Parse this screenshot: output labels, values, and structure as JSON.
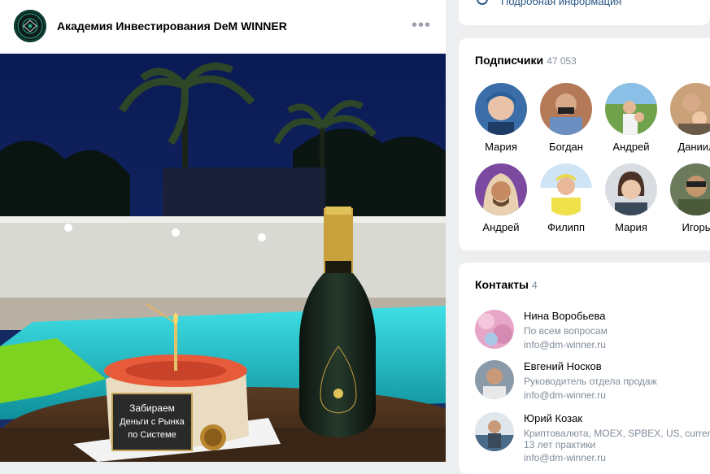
{
  "post": {
    "group_name": "Академия Инвестирования DeM WINNER",
    "more_icon": "more-horizontal-icon",
    "photo": {
      "cake_lines": [
        "Забираем",
        "Деньги с Рынка",
        "по Системе"
      ]
    }
  },
  "info": {
    "icon": "info-icon",
    "link_label": "Подробная информация"
  },
  "subscribers": {
    "title": "Подписчики",
    "count": "47 053",
    "items": [
      {
        "name": "Мария",
        "color": "#3b6ea8"
      },
      {
        "name": "Богдан",
        "color": "#8a6a58"
      },
      {
        "name": "Андрей",
        "color": "#5b8a3c"
      },
      {
        "name": "Даниил",
        "color": "#a07a52"
      },
      {
        "name": "Андрей",
        "color": "#7b4aa0"
      },
      {
        "name": "Филипп",
        "color": "#4d8fcf"
      },
      {
        "name": "Мария",
        "color": "#6f8fa8"
      },
      {
        "name": "Игорь",
        "color": "#5a6a4a"
      }
    ]
  },
  "contacts": {
    "title": "Контакты",
    "count": "4",
    "items": [
      {
        "name": "Нина Воробьева",
        "role": "По всем вопросам",
        "role2": "",
        "email": "info@dm-winner.ru",
        "color": "#e7a6c8"
      },
      {
        "name": "Евгений Носков",
        "role": "Руководитель отдела продаж",
        "role2": "",
        "email": "info@dm-winner.ru",
        "color": "#6b5a4a"
      },
      {
        "name": "Юрий Козак",
        "role": "Криптовалюта, MOEX, SPBEX, US, currenc",
        "role2": "13 лет практики",
        "email": "info@dm-winner.ru",
        "color": "#5c7a9a"
      }
    ]
  }
}
